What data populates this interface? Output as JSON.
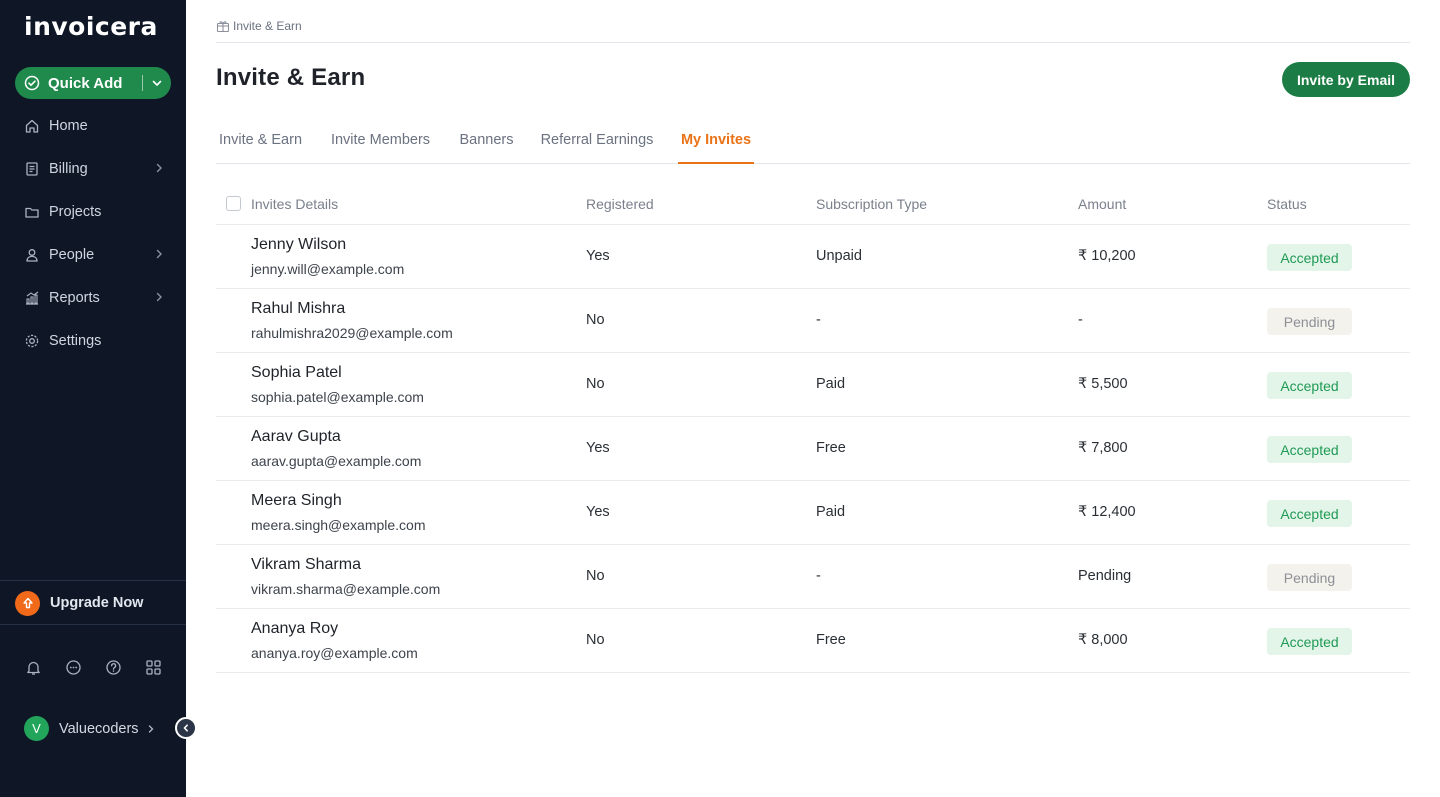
{
  "app": {
    "logo_text": "invoicera"
  },
  "sidebar": {
    "quick_add_label": "Quick Add",
    "items": [
      {
        "label": "Home",
        "icon": "home-icon",
        "has_submenu": false
      },
      {
        "label": "Billing",
        "icon": "billing-icon",
        "has_submenu": true
      },
      {
        "label": "Projects",
        "icon": "folder-icon",
        "has_submenu": false
      },
      {
        "label": "People",
        "icon": "person-icon",
        "has_submenu": true
      },
      {
        "label": "Reports",
        "icon": "chart-icon",
        "has_submenu": true
      },
      {
        "label": "Settings",
        "icon": "gear-icon",
        "has_submenu": false
      }
    ],
    "upgrade_label": "Upgrade Now",
    "utility_icons": [
      "bell-icon",
      "chat-icon",
      "help-icon",
      "apps-grid-icon"
    ],
    "user": {
      "initial": "V",
      "name": "Valuecoders"
    }
  },
  "breadcrumb": {
    "label": "Invite & Earn"
  },
  "page": {
    "title": "Invite & Earn",
    "invite_button": "Invite by Email"
  },
  "tabs": [
    {
      "label": "Invite & Earn",
      "active": false
    },
    {
      "label": "Invite Members",
      "active": false
    },
    {
      "label": "Banners",
      "active": false
    },
    {
      "label": "Referral Earnings",
      "active": false
    },
    {
      "label": "My Invites",
      "active": true
    }
  ],
  "table": {
    "columns": [
      "Invites Details",
      "Registered",
      "Subscription Type",
      "Amount",
      "Status"
    ],
    "rows": [
      {
        "name": "Jenny Wilson",
        "email": "jenny.will@example.com",
        "registered": "Yes",
        "subscription": "Unpaid",
        "amount": "₹ 10,200",
        "status": "Accepted"
      },
      {
        "name": "Rahul Mishra",
        "email": "rahulmishra2029@example.com",
        "registered": "No",
        "subscription": "-",
        "amount": "-",
        "status": "Pending"
      },
      {
        "name": "Sophia Patel",
        "email": "sophia.patel@example.com",
        "registered": "No",
        "subscription": "Paid",
        "amount": "₹ 5,500",
        "status": "Accepted"
      },
      {
        "name": "Aarav Gupta",
        "email": "aarav.gupta@example.com",
        "registered": "Yes",
        "subscription": "Free",
        "amount": "₹ 7,800",
        "status": "Accepted"
      },
      {
        "name": "Meera Singh",
        "email": "meera.singh@example.com",
        "registered": "Yes",
        "subscription": "Paid",
        "amount": "₹ 12,400",
        "status": "Accepted"
      },
      {
        "name": "Vikram Sharma",
        "email": "vikram.sharma@example.com",
        "registered": "No",
        "subscription": "-",
        "amount": "Pending",
        "status": "Pending"
      },
      {
        "name": "Ananya Roy",
        "email": "ananya.roy@example.com",
        "registered": "No",
        "subscription": "Free",
        "amount": "₹ 8,000",
        "status": "Accepted"
      }
    ]
  },
  "colors": {
    "sidebar_bg": "#0f1727",
    "primary_green": "#1b7d45",
    "active_tab": "#ea7317",
    "accepted_text": "#1f9a55",
    "accepted_bg": "#e3f5e8",
    "pending_text": "#8d9096",
    "pending_bg": "#f4f2ec",
    "upgrade_orange": "#f06a1a"
  }
}
